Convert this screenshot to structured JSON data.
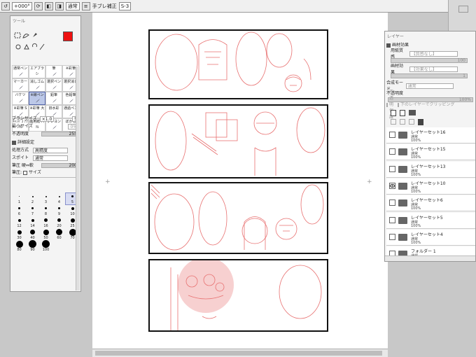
{
  "toolbar": {
    "angle": "+000°",
    "blend_mode": "通常",
    "stabilizer_label": "手ブレ補正",
    "stabilizer_value": "S-3"
  },
  "tool_panel": {
    "title": "ツール",
    "primary_color": "#ee1111",
    "brushes": [
      {
        "label": "通常ペン",
        "selected": false
      },
      {
        "label": "エアブラシ",
        "selected": false
      },
      {
        "label": "筆",
        "selected": false
      },
      {
        "label": "※彩筆",
        "selected": false
      },
      {
        "label": "マーカー",
        "selected": false
      },
      {
        "label": "消しゴム",
        "selected": false
      },
      {
        "label": "選択ペン",
        "selected": false
      },
      {
        "label": "選択消し",
        "selected": false
      },
      {
        "label": "バケツ",
        "selected": false
      },
      {
        "label": "※線ペン",
        "selected": true
      },
      {
        "label": "鉛筆",
        "selected": false
      },
      {
        "label": "色鉛筆",
        "selected": false
      },
      {
        "label": "※彩筆 S",
        "selected": false
      },
      {
        "label": "※彩筆 大",
        "selected": false
      },
      {
        "label": "旧水彩",
        "selected": false
      },
      {
        "label": "通過ペン",
        "selected": false
      },
      {
        "label": "ｷｬﾝﾊﾟｽ ｱｸﾘﾙ",
        "selected": false
      },
      {
        "label": "画用紙 ｱｸﾘﾙ",
        "selected": false
      },
      {
        "label": "クレヨン",
        "selected": false
      },
      {
        "label": "ぼかし",
        "selected": false
      }
    ],
    "brush_size_label": "ブラシサイズ",
    "brush_size_multiplier": "×1.0",
    "brush_size_value": "5",
    "min_size_label": "最小サイズ",
    "min_size_value": "0%",
    "opacity_label": "不透明度",
    "opacity_value": "255",
    "detail_label": "詳細設定",
    "method_label": "処理方式",
    "method_value": "高精度",
    "spuit_label": "スポイト",
    "spuit_value": "通常",
    "pressure_label": "筆圧 硬⇔軟",
    "pressure_value": "200",
    "pressure_size_label": "筆圧:",
    "pressure_size_option": "サイズ",
    "brush_sizes": [
      "1",
      "2",
      "3",
      "4",
      "5",
      "6",
      "7",
      "8",
      "9",
      "10",
      "12",
      "14",
      "16",
      "20",
      "25",
      "30",
      "40",
      "50",
      "60",
      "70",
      "80",
      "90",
      "100"
    ],
    "selected_brush_size": "5"
  },
  "layer_panel": {
    "title": "レイヤー",
    "paper_texture_label": "画材効果",
    "texture_label": "用紙質感",
    "texture_value": "【質感なし】",
    "texture_strength": "100",
    "effect_label": "画材効果",
    "effect_value": "【効果なし】",
    "effect_strength": "1",
    "blend_label": "合成モード",
    "blend_value": "通常",
    "opacity_label": "不透明度",
    "opacity_value": "100%",
    "protect_label": "不透明保護",
    "clip_label": "下のレイヤーでクリッピング",
    "layers": [
      {
        "name": "レイヤーセット16",
        "mode": "通常",
        "opacity": "100%",
        "visible": false
      },
      {
        "name": "レイヤーセット15",
        "mode": "通常",
        "opacity": "100%",
        "visible": false
      },
      {
        "name": "レイヤーセット13",
        "mode": "通常",
        "opacity": "100%",
        "visible": false
      },
      {
        "name": "レイヤーセット10",
        "mode": "通常",
        "opacity": "100%",
        "visible": true
      },
      {
        "name": "レイヤーセット6",
        "mode": "通常",
        "opacity": "100%",
        "visible": false
      },
      {
        "name": "レイヤーセット5",
        "mode": "通常",
        "opacity": "100%",
        "visible": false
      },
      {
        "name": "レイヤーセット4",
        "mode": "通常",
        "opacity": "100%",
        "visible": false
      },
      {
        "name": "フォルダー 1",
        "mode": "通常",
        "opacity": "",
        "visible": false
      }
    ]
  },
  "colors": {
    "sketch": "#e87070",
    "accent": "#ee1111",
    "selection": "#bcc8e8"
  }
}
